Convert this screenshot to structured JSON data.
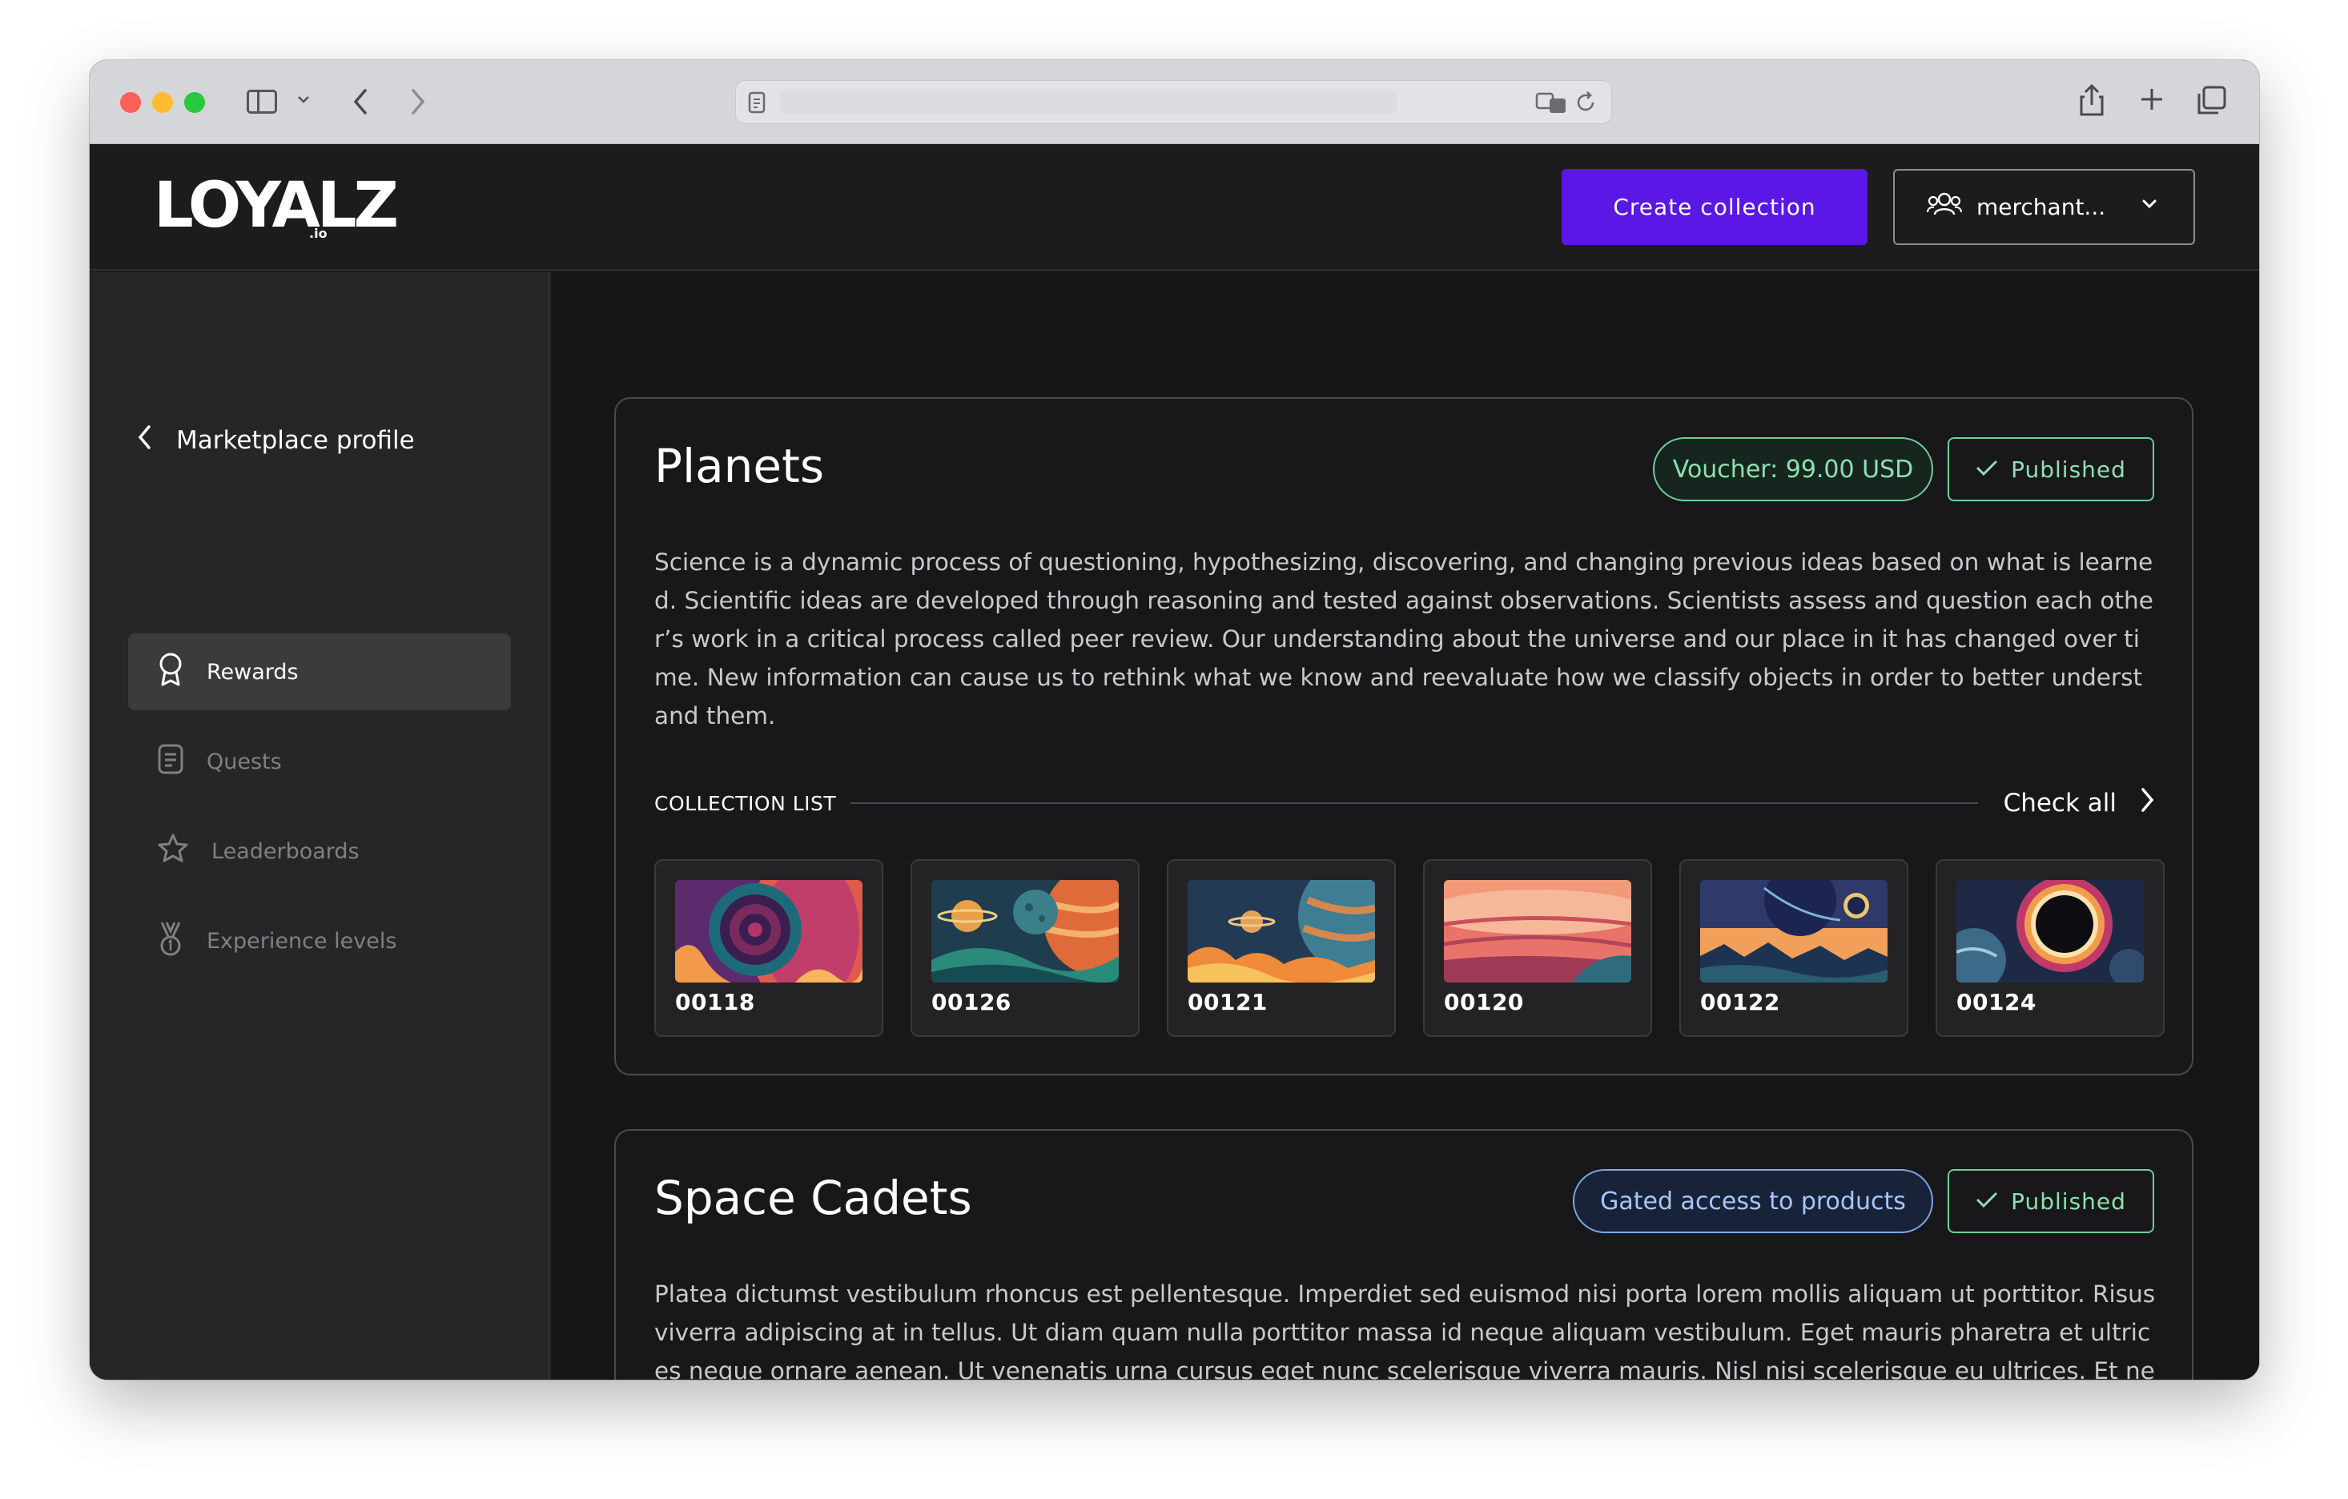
{
  "browser": {
    "address_text": ""
  },
  "header": {
    "logo_text": "LOYALZ",
    "logo_suffix": ".io",
    "create_button": "Create collection",
    "account_button": "merchant..."
  },
  "sidebar": {
    "back_label": "Marketplace profile",
    "items": [
      {
        "label": "Rewards",
        "icon": "ribbon-icon",
        "active": true
      },
      {
        "label": "Quests",
        "icon": "document-icon",
        "active": false
      },
      {
        "label": "Leaderboards",
        "icon": "star-icon",
        "active": false
      },
      {
        "label": "Experience levels",
        "icon": "medal-icon",
        "active": false
      }
    ]
  },
  "collections": [
    {
      "title": "Planets",
      "badge": "Voucher: 99.00 USD",
      "badge_color": "#6fcf97",
      "status": "Published",
      "description": "Science is a dynamic process of questioning, hypothesizing, discovering, and changing previous ideas based on what is learned. Scientific ideas are developed through reasoning and tested against observations. Scientists assess and question each other’s work in a critical process called peer review. Our understanding about the universe and our place in it has changed over time. New information can cause us to rethink what we know and reevaluate how we classify objects in order to better understand them.",
      "list_label": "COLLECTION LIST",
      "check_all": "Check all",
      "items": [
        "00118",
        "00126",
        "00121",
        "00120",
        "00122",
        "00124"
      ]
    },
    {
      "title": "Space Cadets",
      "badge": "Gated access to products",
      "badge_color": "#7ea8e6",
      "status": "Published",
      "description": "Platea dictumst vestibulum rhoncus est pellentesque. Imperdiet sed euismod nisi porta lorem mollis aliquam ut porttitor. Risus viverra adipiscing at in tellus. Ut diam quam nulla porttitor massa id neque aliquam vestibulum. Eget mauris pharetra et ultrices neque ornare aenean. Ut venenatis urna cursus eget nunc scelerisque viverra mauris. Nisl nisi scelerisque eu ultrices. Et netus et malesuada fames ac turpis egestas sed tempus. Fringilla phasellus faucibus scelerisque eleifend."
    }
  ],
  "colors": {
    "accent": "#5a17e6",
    "background": "#1c1c1d",
    "success": "#6fcf97",
    "info": "#7ea8e6"
  }
}
